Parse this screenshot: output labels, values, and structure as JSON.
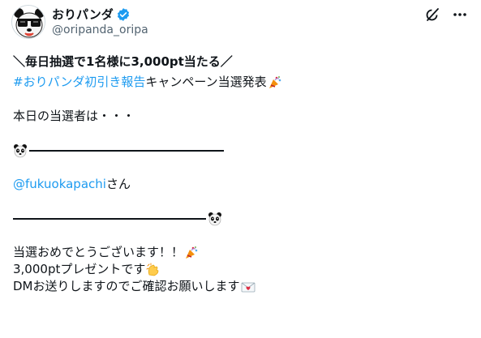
{
  "header": {
    "display_name": "おりパンダ",
    "handle": "@oripanda_oripa"
  },
  "icons": {
    "avatar": "panda-sunglasses-avatar",
    "verified": "verified-badge-icon",
    "grok": "grok-icon",
    "more": "more-icon",
    "party": "party-popper-icon",
    "panda": "panda-face-icon",
    "clap": "clapping-hands-icon",
    "mail": "love-letter-icon"
  },
  "colors": {
    "link": "#1d9bf0",
    "text": "#0f1419",
    "secondary": "#536471"
  },
  "tweet": {
    "headline": "＼毎日抽選で1名様に3,000pt当たる／",
    "hashtag": "#おりパンダ初引き報告",
    "campaign": " キャンペーン当選発表",
    "announce": "本日の当選者は・・・",
    "winner_mention": "@fukuokapachi",
    "winner_suffix": " さん",
    "congrats": "当選おめでとうございます！！",
    "prize": "3,000ptプレゼントです",
    "dm_notice": "DMお送りしますのでご確認お願いします"
  }
}
